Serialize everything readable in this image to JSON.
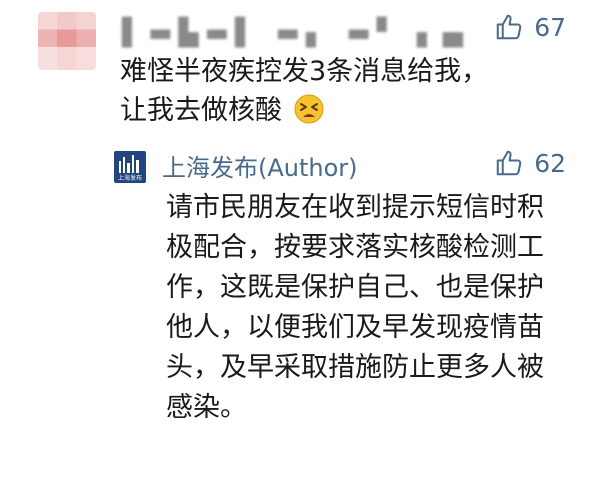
{
  "comment": {
    "username": "▌▬▙▬▌ ▬▖ ▬▘ ▖▄",
    "likes": "67",
    "text_line1": "难怪半夜疾控发3条消息给我，",
    "text_line2": "让我去做核酸"
  },
  "reply": {
    "author": "上海发布(Author)",
    "avatar_caption": "上海发布",
    "likes": "62",
    "text": "请市民朋友在收到提示短信时积极配合，按要求落实核酸检测工作，这既是保护自己、也是保护他人，以便我们及早发现疫情苗头，及早采取措施防止更多人被感染。"
  },
  "icons": {
    "like": "thumbs-up-icon",
    "emoji": "tired-face-emoji-icon"
  },
  "colors": {
    "accent": "#4a6a8c",
    "text": "#1a1a1a",
    "author_avatar": "#21457c"
  }
}
